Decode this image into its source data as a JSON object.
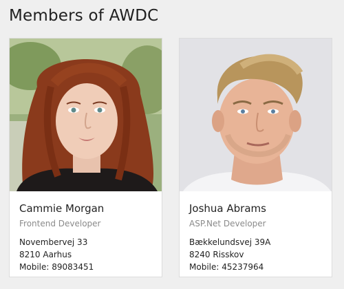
{
  "page": {
    "title": "Members of AWDC"
  },
  "members": [
    {
      "name": "Cammie Morgan",
      "role": "Frontend Developer",
      "address": "Novembervej 33",
      "city": "8210 Aarhus",
      "mobile": "Mobile: 89083451",
      "photo_icon": "portrait-photo"
    },
    {
      "name": "Joshua Abrams",
      "role": "ASP.Net Developer",
      "address": "Bækkelundsvej 39A",
      "city": "8240 Risskov",
      "mobile": "Mobile: 45237964",
      "photo_icon": "portrait-photo"
    }
  ],
  "colors": {
    "background": "#efefef",
    "card": "#ffffff",
    "role_text": "#8a8a8a"
  }
}
